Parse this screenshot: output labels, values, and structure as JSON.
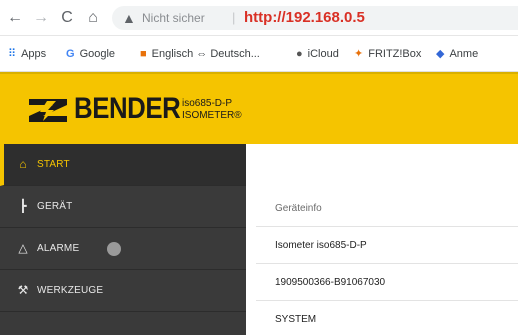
{
  "browser": {
    "security_label": "Nicht sicher",
    "separator": "|",
    "url": "http://192.168.0.5"
  },
  "bookmarks": [
    {
      "label": "Apps",
      "icon": "apps-grid-icon"
    },
    {
      "label": "Google",
      "icon": "google-icon"
    },
    {
      "label": "Englisch ⇔ Deutsch...",
      "icon": "dictionary-icon"
    },
    {
      "label": "iCloud",
      "icon": "apple-icon"
    },
    {
      "label": "FRITZ!Box",
      "icon": "fritzbox-icon"
    },
    {
      "label": "Anme",
      "icon": "bookmark-icon"
    }
  ],
  "header": {
    "brand": "BENDER",
    "product_line1": "iso685-D-P",
    "product_line2": "ISOMETER®",
    "accent_color": "#f5c400"
  },
  "sidebar": {
    "items": [
      {
        "label": "START",
        "icon": "home-icon",
        "active": true
      },
      {
        "label": "GERÄT",
        "icon": "device-tree-icon",
        "active": false
      },
      {
        "label": "ALARME",
        "icon": "warning-triangle-icon",
        "active": false
      },
      {
        "label": "WERKZEUGE",
        "icon": "wrench-icon",
        "active": false
      }
    ]
  },
  "main": {
    "rows": [
      {
        "text": "Geräteinfo"
      },
      {
        "text": "Isometer iso685-D-P"
      },
      {
        "text": "1909500366-B91067030"
      },
      {
        "text": "SYSTEM"
      }
    ]
  }
}
